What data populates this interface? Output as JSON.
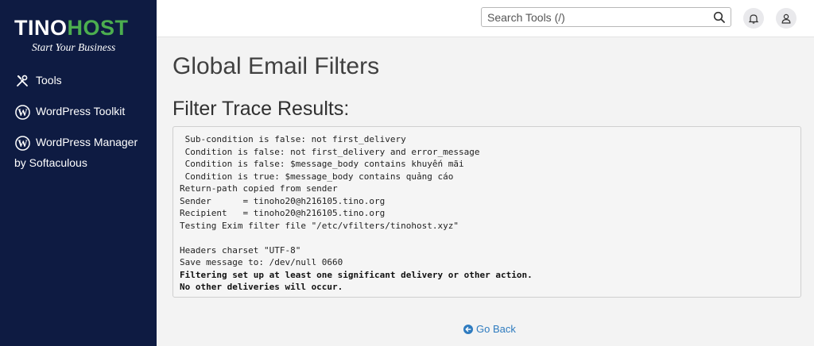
{
  "brand": {
    "name_part1": "TINO",
    "name_part2": "HOST",
    "tagline": "Start Your Business"
  },
  "sidebar": {
    "items": [
      {
        "label": "Tools",
        "icon": "tools-icon"
      },
      {
        "label": "WordPress Toolkit",
        "icon": "wordpress-icon"
      },
      {
        "label": "WordPress Manager",
        "sub": "by Softaculous",
        "icon": "wordpress-icon"
      }
    ]
  },
  "header": {
    "search_placeholder": "Search Tools (/)"
  },
  "main": {
    "page_title": "Global Email Filters",
    "section_title": "Filter Trace Results:",
    "trace_lines": [
      {
        "text": " Sub-condition is false: not first_delivery",
        "bold": false
      },
      {
        "text": " Condition is false: not first_delivery and error_message",
        "bold": false
      },
      {
        "text": " Condition is false: $message_body contains khuyến mãi",
        "bold": false
      },
      {
        "text": " Condition is true: $message_body contains quảng cáo",
        "bold": false
      },
      {
        "text": "Return-path copied from sender",
        "bold": false
      },
      {
        "text": "Sender      = tinoho20@h216105.tino.org",
        "bold": false
      },
      {
        "text": "Recipient   = tinoho20@h216105.tino.org",
        "bold": false
      },
      {
        "text": "Testing Exim filter file \"/etc/vfilters/tinohost.xyz\"",
        "bold": false
      },
      {
        "text": "",
        "bold": false
      },
      {
        "text": "Headers charset \"UTF-8\"",
        "bold": false
      },
      {
        "text": "Save message to: /dev/null 0660",
        "bold": false
      },
      {
        "text": "Filtering set up at least one significant delivery or other action.",
        "bold": true
      },
      {
        "text": "No other deliveries will occur.",
        "bold": true
      }
    ],
    "go_back_label": "Go Back"
  },
  "colors": {
    "sidebar_bg": "#0e1b42",
    "brand_green": "#4cae4f",
    "link_blue": "#2e7bbf"
  }
}
